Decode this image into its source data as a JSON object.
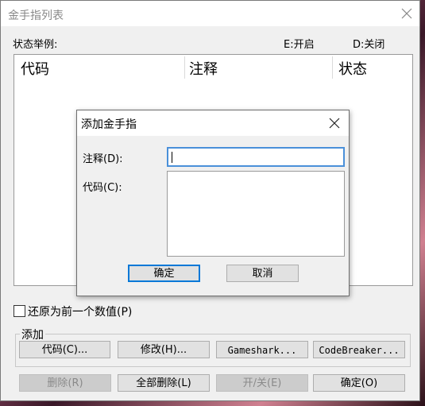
{
  "window": {
    "title": "金手指列表"
  },
  "legend": {
    "label": "状态举例:",
    "enabled": "E:开启",
    "disabled": "D:关闭"
  },
  "list": {
    "columns": [
      "代码",
      "注释",
      "状态"
    ]
  },
  "restore_checkbox": {
    "label": "还原为前一个数值(P)",
    "checked": false
  },
  "add_group": {
    "label": "添加",
    "buttons": [
      "代码(C)...",
      "修改(H)...",
      "Gameshark...",
      "CodeBreaker..."
    ]
  },
  "bottom_buttons": {
    "delete": "删除(R)",
    "delete_all": "全部删除(L)",
    "toggle": "开/关(E)",
    "ok": "确定(O)"
  },
  "dialog": {
    "title": "添加金手指",
    "comment_label": "注释(D):",
    "comment_value": "",
    "code_label": "代码(C):",
    "code_value": "",
    "ok": "确定",
    "cancel": "取消"
  }
}
